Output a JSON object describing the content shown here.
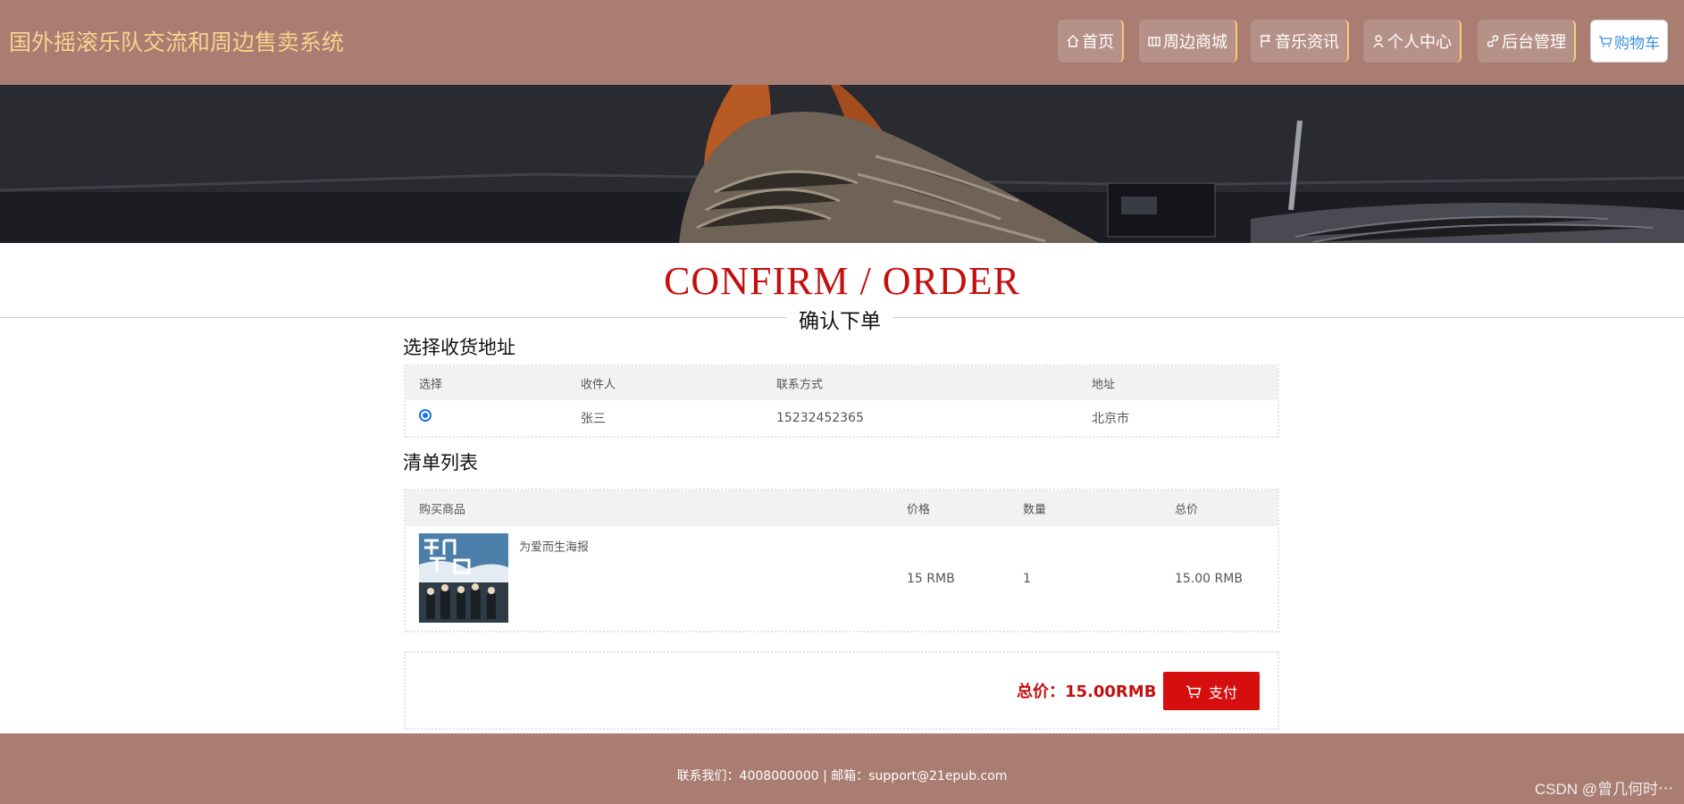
{
  "header": {
    "site_title": "国外摇滚乐队交流和周边售卖系统",
    "nav": [
      {
        "label": "首页",
        "icon": "home-icon"
      },
      {
        "label": "周边商城",
        "icon": "shop-icon"
      },
      {
        "label": "音乐资讯",
        "icon": "flag-icon"
      },
      {
        "label": "个人中心",
        "icon": "user-icon"
      },
      {
        "label": "后台管理",
        "icon": "link-icon"
      },
      {
        "label": "购物车",
        "icon": "cart-icon"
      }
    ]
  },
  "page": {
    "title": "CONFIRM / ORDER",
    "subtitle": "确认下单"
  },
  "address_section": {
    "label": "选择收货地址",
    "columns": [
      "选择",
      "收件人",
      "联系方式",
      "地址"
    ],
    "rows": [
      {
        "selected": true,
        "recipient": "张三",
        "phone": "15232452365",
        "address": "北京市"
      }
    ]
  },
  "order_section": {
    "label": "清单列表",
    "columns": [
      "购买商品",
      "价格",
      "数量",
      "总价"
    ],
    "items": [
      {
        "name": "为爱而生海报",
        "price": "15 RMB",
        "quantity": "1",
        "subtotal": "15.00 RMB"
      }
    ]
  },
  "summary": {
    "total_text": "总价：15.00RMB",
    "pay_label": "支付"
  },
  "footer": {
    "text": "联系我们：4008000000 | 邮箱：support@21epub.com"
  },
  "watermark": "CSDN @曾几何时⋯",
  "colors": {
    "header_bg": "#a97d72",
    "title_color": "#f4d58d",
    "accent_red": "#c40f0f",
    "pay_button": "#d60e0e"
  }
}
